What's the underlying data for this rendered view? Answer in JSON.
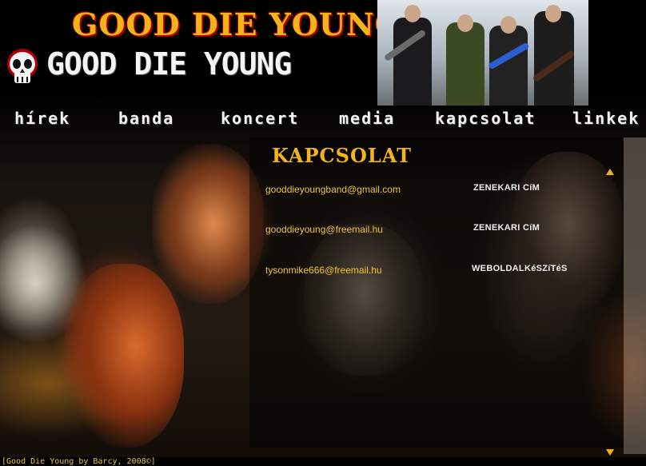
{
  "header": {
    "logo_top": "GOOD DIE YOUNG",
    "logo_main": "GOOD DIE YOUNG"
  },
  "nav": {
    "items": [
      {
        "label": "hírek"
      },
      {
        "label": "banda"
      },
      {
        "label": "koncert"
      },
      {
        "label": "media"
      },
      {
        "label": "kapcsolat"
      },
      {
        "label": "linkek"
      }
    ]
  },
  "main": {
    "section_title": "KAPCSOLAT",
    "contacts": [
      {
        "email": "gooddieyoungband@gmail.com",
        "role": "ZENEKARI CíM"
      },
      {
        "email": "gooddieyoung@freemail.hu",
        "role": "ZENEKARI CíM"
      },
      {
        "email": "tysonmike666@freemail.hu",
        "role": "WEBOLDALKéSZíTéS"
      }
    ]
  },
  "footer": {
    "text": "[Good Die Young by Barcy, 2008©]"
  },
  "colors": {
    "accent": "#f2b418",
    "logo_red": "#b00000",
    "email": "#f3c62a",
    "nav_text": "#f2f2f2"
  },
  "icons": {
    "logo_icon": "skull-icon",
    "scroll_up": "triangle-up-icon",
    "scroll_down": "triangle-down-icon"
  }
}
